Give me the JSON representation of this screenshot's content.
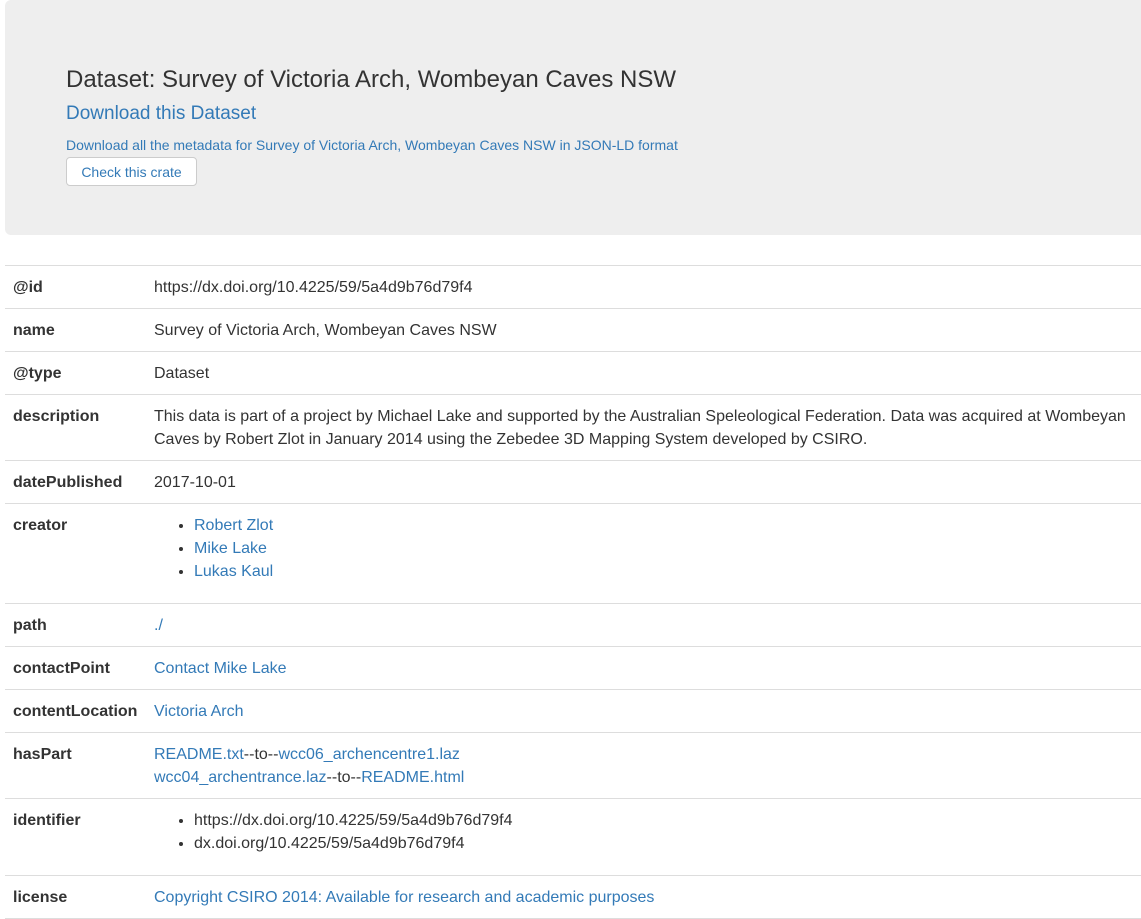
{
  "header": {
    "title": "Dataset: Survey of Victoria Arch, Wombeyan Caves NSW",
    "download_link": "Download this Dataset",
    "metadata_link": "Download all the metadata for Survey of Victoria Arch, Wombeyan Caves NSW in JSON-LD format",
    "check_button": "Check this crate"
  },
  "rows": {
    "id": {
      "key": "@id",
      "value": "https://dx.doi.org/10.4225/59/5a4d9b76d79f4"
    },
    "name": {
      "key": "name",
      "value": "Survey of Victoria Arch, Wombeyan Caves NSW"
    },
    "type": {
      "key": "@type",
      "value": "Dataset"
    },
    "description": {
      "key": "description",
      "value": "This data is part of a project by Michael Lake and supported by the Australian Speleological Federation. Data was acquired at Wombeyan Caves by Robert Zlot in January 2014 using the Zebedee 3D Mapping System developed by CSIRO."
    },
    "datePublished": {
      "key": "datePublished",
      "value": "2017-10-01"
    },
    "creator": {
      "key": "creator",
      "items": [
        "Robert Zlot",
        "Mike Lake",
        "Lukas Kaul"
      ]
    },
    "path": {
      "key": "path",
      "value": "./"
    },
    "contactPoint": {
      "key": "contactPoint",
      "value": "Contact Mike Lake"
    },
    "contentLocation": {
      "key": "contentLocation",
      "value": "Victoria Arch"
    },
    "hasPart": {
      "key": "hasPart",
      "separator": "--to--",
      "pairs": [
        {
          "from": "README.txt",
          "to": "wcc06_archencentre1.laz"
        },
        {
          "from": "wcc04_archentrance.laz",
          "to": "README.html"
        }
      ]
    },
    "identifier": {
      "key": "identifier",
      "items": [
        "https://dx.doi.org/10.4225/59/5a4d9b76d79f4",
        "dx.doi.org/10.4225/59/5a4d9b76d79f4"
      ]
    },
    "license": {
      "key": "license",
      "value": "Copyright CSIRO 2014: Available for research and academic purposes"
    }
  },
  "colors": {
    "link": "#337ab7",
    "header_bg": "#eeeeee",
    "text": "#333333",
    "border": "#dddddd"
  }
}
